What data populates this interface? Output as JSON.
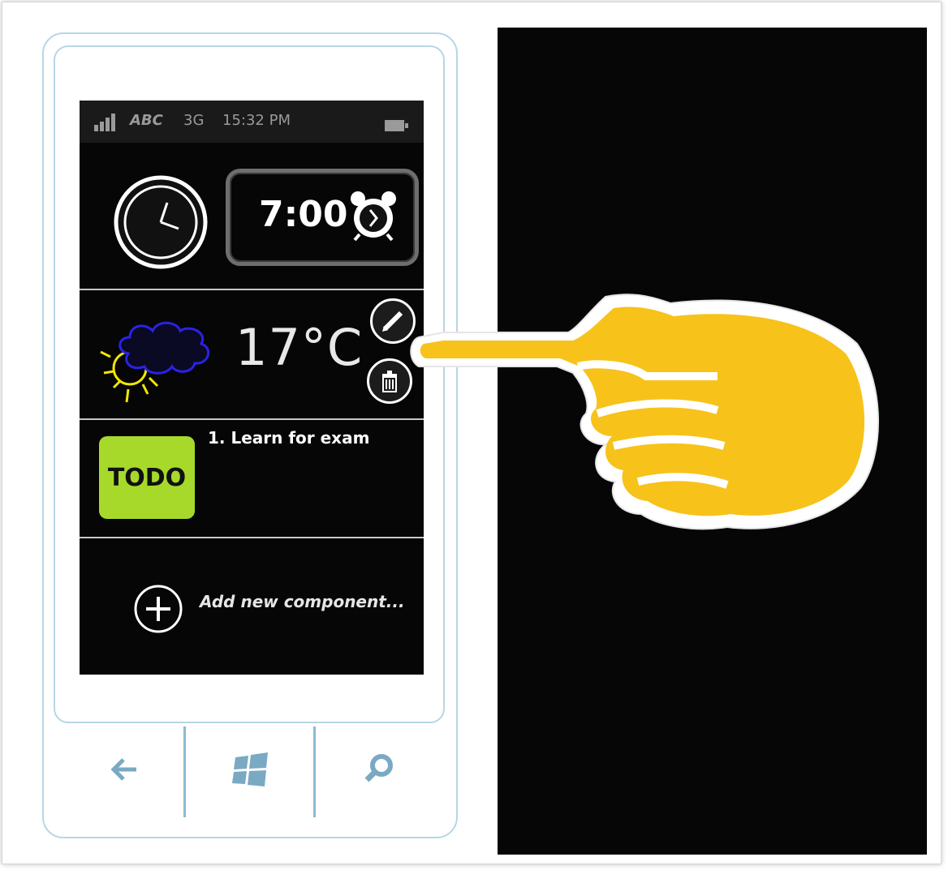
{
  "statusbar": {
    "carrier": "ABC",
    "network": "3G",
    "time": "15:32 PM",
    "signal_icon": "signal-bars-icon",
    "battery_icon": "battery-icon"
  },
  "alarm_tile": {
    "clock_icon": "clock-icon",
    "time": "7:00",
    "alarm_icon": "alarm-clock-icon"
  },
  "weather_tile": {
    "icon": "cloud-sun-icon",
    "temperature": "17°C",
    "edit_icon": "pencil-icon",
    "delete_icon": "trash-icon"
  },
  "todo_tile": {
    "label": "TODO",
    "items": [
      "1. Learn for exam"
    ]
  },
  "add_component": {
    "icon": "plus-circle-icon",
    "label": "Add new component..."
  },
  "hardware_buttons": [
    "back-arrow-icon",
    "windows-logo-icon",
    "search-icon"
  ],
  "overlay": {
    "icon": "pointing-hand-icon"
  },
  "colors": {
    "screen_bg": "#060606",
    "phone_outline": "#b6d6e6",
    "todo_green": "#a6d92a",
    "hand_yellow": "#f7c21a",
    "cloud_blue": "#2a22e6",
    "sun_yellow": "#f2e600"
  }
}
